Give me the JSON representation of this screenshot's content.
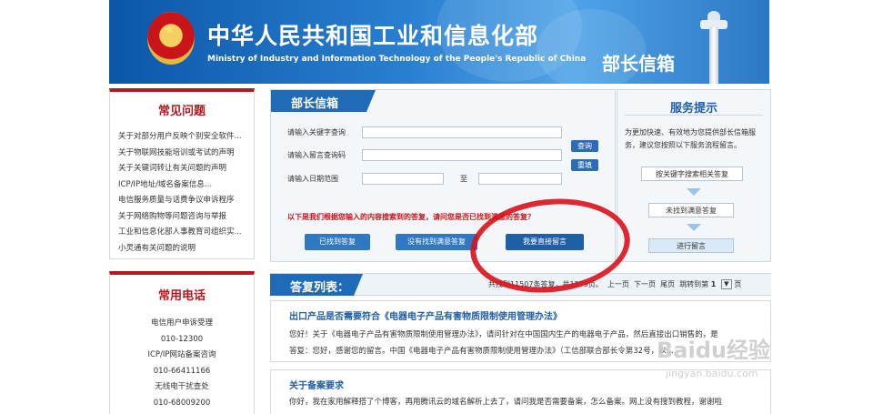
{
  "header": {
    "title": "中华人民共和国工业和信息化部",
    "subtitle": "Ministry of Industry and Information Technology of the People's Republic of China",
    "section": "部长信箱"
  },
  "faq": {
    "title": "常见问题",
    "items": [
      "关于对部分用户反映个别安全软件...",
      "关于物联网技能培训或考试的声明",
      "关于关键词转让有关问题的声明",
      "ICP/IP地址/域名备案信息...",
      "电信服务质量与话费争议申诉程序",
      "关于网络购物等问题咨询与举报",
      "工业和信息化部人事教育司组织实...",
      "小灵通有关问题的说明"
    ]
  },
  "phones": {
    "title": "常用电话",
    "lines": [
      "电信用户申诉受理",
      "010-12300",
      "ICP/IP网站备案咨询",
      "010-66411166",
      "无线电干扰查处",
      "010-68009200"
    ]
  },
  "minister": {
    "title": "部长信箱",
    "keyword_label": "请输入关键字查询",
    "code_label": "请输入留言查询码",
    "date_label": "请输入日期范围",
    "to_label": "至",
    "search_btn": "查询",
    "reset_btn": "重填",
    "notice": "以下是我们根据您输入的内容搜索到的答复，请问您是否已找到满意的答复？",
    "found_btn": "已找到答复",
    "not_found_btn": "没有找到满意答复",
    "direct_btn": "我要直接留言"
  },
  "service": {
    "title": "服务提示",
    "desc": "为更加快速、有效地为您提供部长信箱服务，建议您按照以下服务流程留言。",
    "step1": "按关键字搜索相关答复",
    "step2": "未找到满意答复",
    "step3": "进行留言"
  },
  "answers": {
    "title": "答复列表：",
    "pager": "共找到11507条答复，共1279页。",
    "prev": "上一页",
    "next": "下一页",
    "last": "尾页",
    "jump": "跳转到第",
    "page": "1",
    "page_suffix": "页"
  },
  "items": [
    {
      "title": "出口产品是否需要符合《电器电子产品有害物质限制使用管理办法》",
      "q": "您好！关于《电器电子产品有害物质限制使用管理办法》，请问针对在中国国内生产的电器电子产品，然后直接出口销售的，是",
      "a": "答复：您好，感谢您的留言。中国《电器电子产品有害物质限制使用管理办法》（工信部联合部长令第32号，以..."
    },
    {
      "title": "关于备案要求",
      "q": "你好，我在家用解释搭了个博客，再用腾讯云的域名解析上去了，请问我是否需要备案，怎么备案。网上没有搜到教程，谢谢啦",
      "a": ""
    }
  ],
  "watermark": {
    "main": "Baidu经验",
    "sub": "jingyan.baidu.com"
  }
}
